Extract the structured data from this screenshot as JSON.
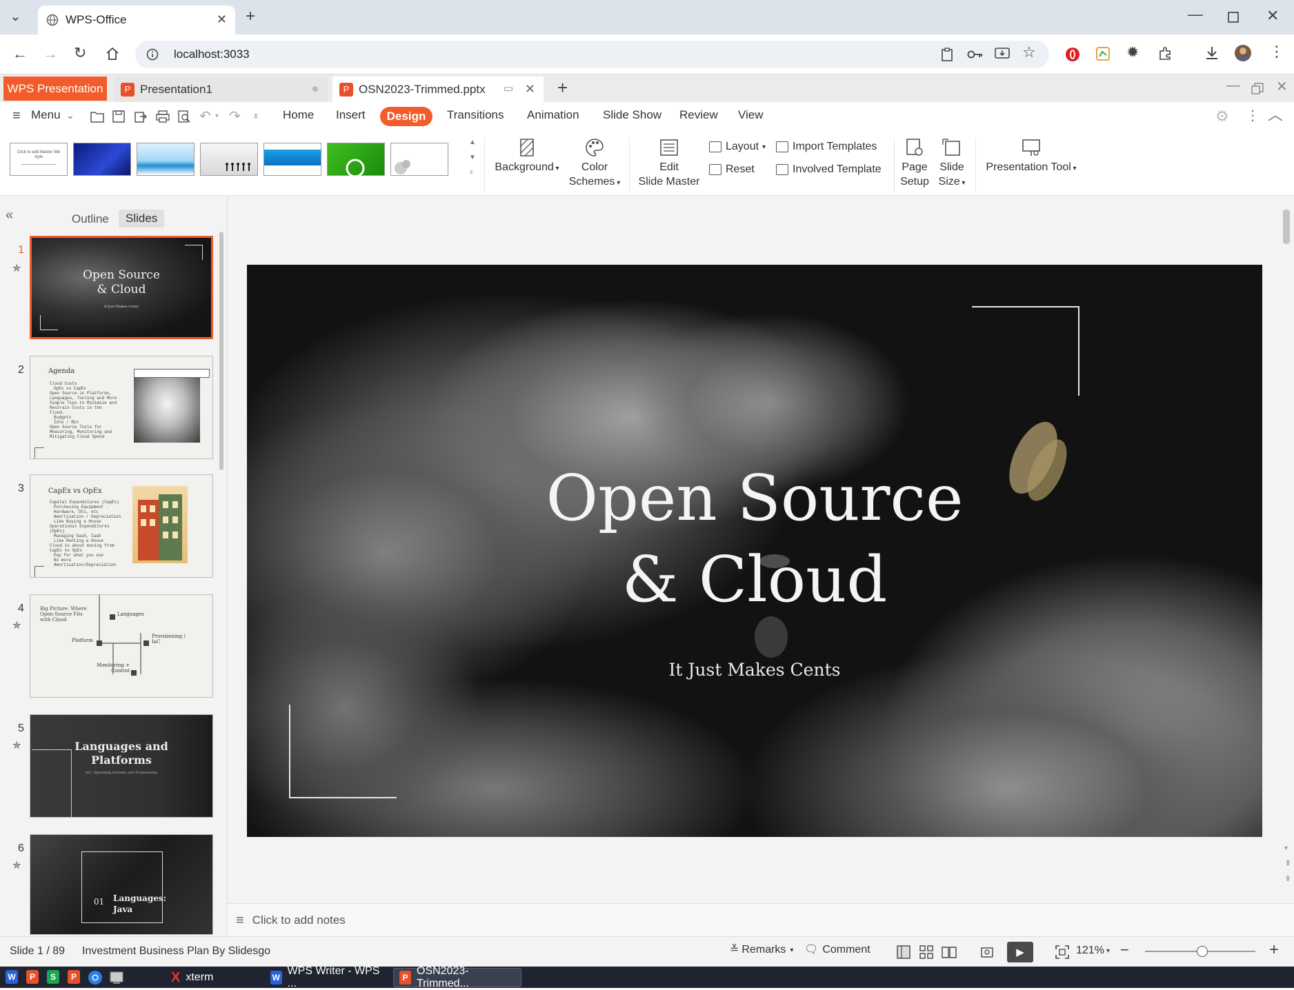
{
  "browser": {
    "tab_title": "WPS-Office",
    "url": "localhost:3033"
  },
  "wps_tabs": {
    "app": "WPS Presentation",
    "doc1": "Presentation1",
    "doc2": "OSN2023-Trimmed.pptx"
  },
  "menu": {
    "menu": "Menu",
    "home": "Home",
    "insert": "Insert",
    "design": "Design",
    "transitions": "Transitions",
    "animation": "Animation",
    "slideshow": "Slide Show",
    "review": "Review",
    "view": "View"
  },
  "ribbon": {
    "background": "Background",
    "color1": "Color",
    "color2": "Schemes",
    "edit1": "Edit",
    "edit2": "Slide Master",
    "layout": "Layout",
    "reset": "Reset",
    "import_templates": "Import Templates",
    "involved_template": "Involved Template",
    "page1": "Page",
    "page2": "Setup",
    "size1": "Slide",
    "size2": "Size",
    "presentation_tool": "Presentation Tool",
    "theme_thumb1_text": "Click to add Master title style"
  },
  "panel": {
    "outline": "Outline",
    "slides": "Slides"
  },
  "slides": [
    {
      "num": "1",
      "title1": "Open Source",
      "title2": "& Cloud",
      "sub": "It Just Makes Cents"
    },
    {
      "num": "2",
      "title": "Agenda",
      "lines": [
        "Cloud Costs",
        "OpEx vs CapEx",
        "Open Source in Platforms, Languages, Tooling and More",
        "Simple Tips to Minimise and Restrain Costs in the Cloud.",
        "Budgets",
        "Idle / Bin",
        "Open Source Tools for Measuring, Monitoring and Mitigating Cloud Spend"
      ]
    },
    {
      "num": "3",
      "title": "CapEx vs OpEx",
      "lines": [
        "Capital Expenditures (CapEx)",
        "Purchasing Equipment - Hardware, DCs, etc",
        "Amortisation / Depreciation",
        "Like Buying a House",
        "Operational Expenditures (OpEx)",
        "Managing SaaS, IaaS",
        "Like Renting a House",
        "Cloud is about moving from CapEx to OpEx",
        "Pay for what you use",
        "No more Amortisation/Depreciation"
      ]
    },
    {
      "num": "4",
      "title": "Big Picture: Where Open-Source Fits with Cloud",
      "labels": [
        "Languages",
        "Platform",
        "Provisioning / IaC",
        "Monitoring + Control"
      ]
    },
    {
      "num": "5",
      "title1": "Languages and",
      "title2": "Platforms",
      "sub": "IaC, Operating Systems and Frameworks"
    },
    {
      "num": "6",
      "num_label": "01",
      "title1": "Languages:",
      "title2": "Java"
    }
  ],
  "main_slide": {
    "title_line1": "Open Source",
    "title_line2": "& Cloud",
    "subtitle": "It Just Makes Cents"
  },
  "notes_placeholder": "Click to add notes",
  "status": {
    "slide": "Slide 1 / 89",
    "theme": "Investment Business Plan By Slidesgo",
    "remarks": "Remarks",
    "comment": "Comment",
    "zoom": "121%"
  },
  "taskbar": {
    "xterm": "xterm",
    "writer": "WPS Writer - WPS ...",
    "pres": "OSN2023-Trimmed..."
  },
  "colors": {
    "accent": "#f25c2a",
    "browser_bar": "#dde3ea",
    "taskbar": "#1f2430"
  }
}
